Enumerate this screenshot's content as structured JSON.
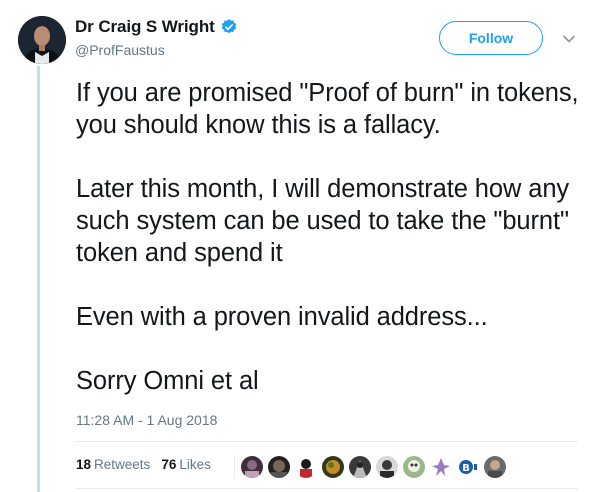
{
  "author": {
    "display_name": "Dr Craig S Wright",
    "handle": "@ProfFaustus",
    "verified_icon": "verified-badge-icon",
    "avatar_icon": "profile-photo"
  },
  "follow_button": {
    "label": "Follow"
  },
  "menu_icon": "chevron-down-icon",
  "tweet": {
    "paragraphs": [
      "If you are promised \"Proof of burn\" in tokens, you should know this is a fallacy.",
      "Later this month, I will demonstrate how any such system can be used to take the \"burnt\" token and spend it",
      "Even with a proven invalid address...",
      "Sorry Omni et al"
    ],
    "timestamp": "11:28 AM - 1 Aug 2018"
  },
  "stats": {
    "retweets_count": "18",
    "retweets_label": "Retweets",
    "likes_count": "76",
    "likes_label": "Likes"
  },
  "likers": [
    {
      "icon": "liker-avatar-1",
      "color": "#5a4a52"
    },
    {
      "icon": "liker-avatar-2",
      "color": "#2d2d2d"
    },
    {
      "icon": "liker-avatar-3",
      "color": "#c22b2b"
    },
    {
      "icon": "liker-avatar-4",
      "color": "#6a5a2a"
    },
    {
      "icon": "liker-avatar-5",
      "color": "#3a3a3a"
    },
    {
      "icon": "liker-avatar-6",
      "color": "#4a4a4a"
    },
    {
      "icon": "liker-avatar-7",
      "color": "#6a8a5a"
    },
    {
      "icon": "liker-avatar-8",
      "color": "#9a7ac0"
    },
    {
      "icon": "liker-avatar-9",
      "color": "#1a5fa8"
    },
    {
      "icon": "liker-avatar-10",
      "color": "#7a7a7a"
    }
  ],
  "colors": {
    "accent": "#1da1f2",
    "secondary_text": "#657786",
    "thread_line": "#c2dff2"
  }
}
